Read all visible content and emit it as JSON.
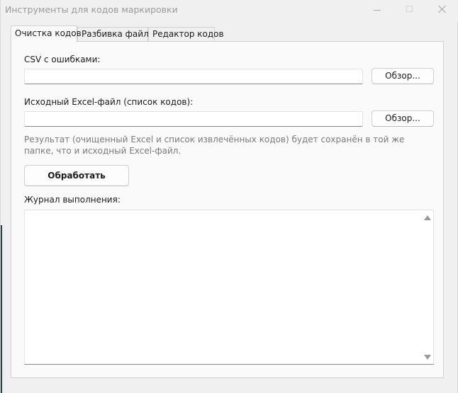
{
  "window": {
    "title": "Инструменты для кодов маркировки"
  },
  "tabs": [
    {
      "label": "Очистка кодов",
      "active": true
    },
    {
      "label": "Разбивка файла",
      "active": false
    },
    {
      "label": "Редактор кодов",
      "active": false
    }
  ],
  "cleanup": {
    "csv_label": "CSV с ошибками:",
    "csv_value": "",
    "excel_label": "Исходный Excel-файл (список кодов):",
    "excel_value": "",
    "browse_label": "Обзор...",
    "hint": "Результат (очищенный Excel и список извлечённых кодов) будет сохранён в той же папке, что и исходный Excel-файл.",
    "process_label": "Обработать",
    "log_label": "Журнал выполнения:",
    "log_text": ""
  },
  "colors": {
    "window_bg": "#f0f0f0",
    "panel_bg": "#fafafa",
    "hint_text": "#7a7a7a",
    "title_text": "#9a9a9a"
  }
}
